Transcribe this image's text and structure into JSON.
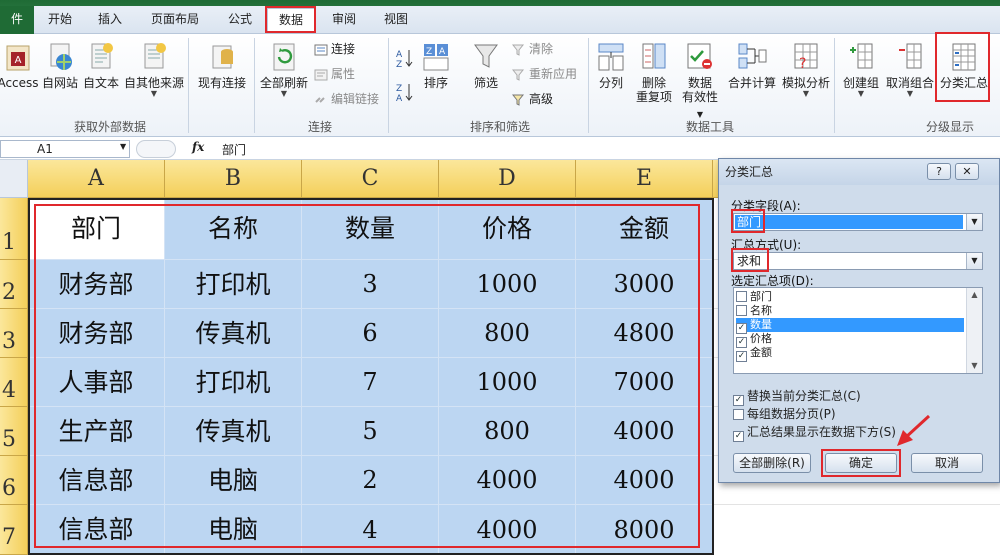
{
  "tabs": [
    "件",
    "开始",
    "插入",
    "页面布局",
    "公式",
    "数据",
    "审阅",
    "视图"
  ],
  "ribbon": {
    "get_external": {
      "label": "获取外部数据",
      "buttons": [
        "Access",
        "自网站",
        "自文本",
        "自其他来源",
        "现有连接"
      ]
    },
    "connections": {
      "label": "连接",
      "refresh_all": "全部刷新",
      "connect": "连接",
      "properties": "属性",
      "edit_links": "编辑链接"
    },
    "sort_filter": {
      "label": "排序和筛选",
      "sort": "排序",
      "filter": "筛选",
      "clear": "清除",
      "reapply": "重新应用",
      "advanced": "高级"
    },
    "data_tools": {
      "label": "数据工具",
      "split": "分列",
      "remove_dup_1": "删除",
      "remove_dup_2": "重复项",
      "validation_1": "数据",
      "validation_2": "有效性",
      "consolidate": "合并计算",
      "whatif": "模拟分析"
    },
    "outline": {
      "label": "分级显示",
      "group": "创建组",
      "ungroup": "取消组合",
      "subtotal": "分类汇总"
    }
  },
  "formula_bar": {
    "name_box": "A1",
    "fx": "fx",
    "content": "部门"
  },
  "sheet": {
    "columns": [
      "A",
      "B",
      "C",
      "D",
      "E"
    ],
    "rows": [
      "1",
      "2",
      "3",
      "4",
      "5",
      "6",
      "7"
    ],
    "header": [
      "部门",
      "名称",
      "数量",
      "价格",
      "金额"
    ],
    "data": [
      [
        "财务部",
        "打印机",
        "3",
        "1000",
        "3000"
      ],
      [
        "财务部",
        "传真机",
        "6",
        "800",
        "4800"
      ],
      [
        "人事部",
        "打印机",
        "7",
        "1000",
        "7000"
      ],
      [
        "生产部",
        "传真机",
        "5",
        "800",
        "4000"
      ],
      [
        "信息部",
        "电脑",
        "2",
        "4000",
        "4000"
      ],
      [
        "信息部",
        "电脑",
        "4",
        "4000",
        "8000"
      ]
    ]
  },
  "dialog": {
    "title": "分类汇总",
    "help": "?",
    "close": "✕",
    "group_by_label": "分类字段(A):",
    "group_by_value": "部门",
    "function_label": "汇总方式(U):",
    "function_value": "求和",
    "add_to_label": "选定汇总项(D):",
    "fields": [
      {
        "name": "部门",
        "checked": false
      },
      {
        "name": "名称",
        "checked": false
      },
      {
        "name": "数量",
        "checked": true
      },
      {
        "name": "价格",
        "checked": true
      },
      {
        "name": "金额",
        "checked": true
      }
    ],
    "options": [
      {
        "label": "替换当前分类汇总(C)",
        "checked": true
      },
      {
        "label": "每组数据分页(P)",
        "checked": false
      },
      {
        "label": "汇总结果显示在数据下方(S)",
        "checked": true
      }
    ],
    "remove_all": "全部删除(R)",
    "ok": "确定",
    "cancel": "取消"
  },
  "colors": {
    "accent_red": "#e0282c",
    "selection_blue": "#bcd6f2",
    "header_yellow": "#f4cf5a",
    "file_green": "#1f6b35"
  }
}
